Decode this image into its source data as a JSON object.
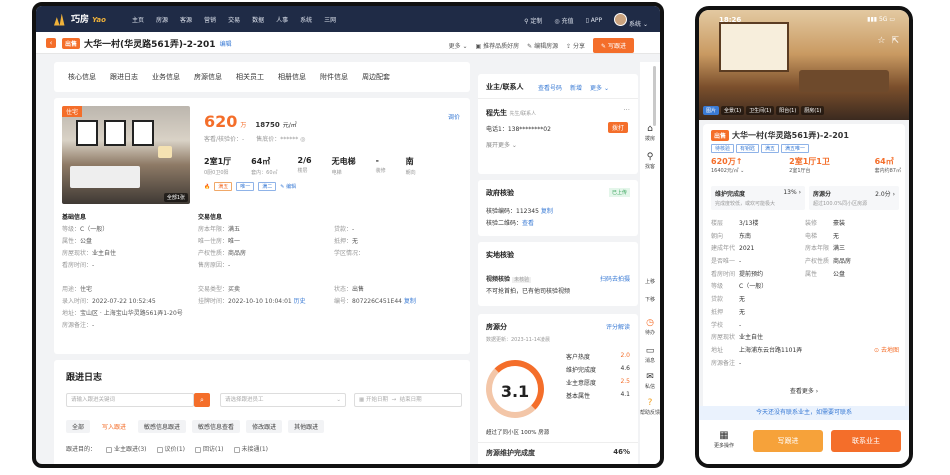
{
  "nav": {
    "logo": "巧房",
    "logo_suffix": "Yao",
    "items": [
      "主页",
      "房源",
      "客源",
      "营销",
      "交易",
      "数据",
      "人事",
      "系统",
      "三网"
    ],
    "right": [
      "定制",
      "充值",
      "APP",
      "系统"
    ]
  },
  "titlebar": {
    "tag": "出售",
    "title": "大华一村(华灵路561弄)-2-201",
    "edit": "编辑",
    "actions": [
      "更多",
      "推荐品质好房",
      "编辑房源",
      "分享"
    ],
    "follow_btn": "写跟进"
  },
  "tabs": [
    "核心信息",
    "跟进日志",
    "业务信息",
    "房源信息",
    "相关员工",
    "相册信息",
    "附件信息",
    "周边配套"
  ],
  "listing": {
    "rent_tag": "住宅",
    "all_photos": "全部1张",
    "price": "620",
    "price_unit": "万",
    "unit_price": "18750",
    "unit_price_label": "元/㎡",
    "adjust": "调价",
    "sub1": "客看/核验价：-",
    "sub2": "售底价：****** ◎",
    "stats": [
      {
        "v": "2室1厅",
        "l": "0厨0卫0阳"
      },
      {
        "v": "64㎡",
        "l": "套内：60㎡"
      },
      {
        "v": "2/6",
        "l": "楼层"
      },
      {
        "v": "无电梯",
        "l": "电梯"
      },
      {
        "v": "-",
        "l": "装修"
      },
      {
        "v": "南",
        "l": "朝向"
      }
    ],
    "chips": [
      "满五",
      "唯一",
      "满二"
    ],
    "chip_edit": "编辑"
  },
  "basic": {
    "title": "基础信息",
    "rows": [
      [
        "等级：",
        "C（一般）"
      ],
      [
        "属性：",
        "公盘"
      ],
      [
        "房屋现状：",
        "业主自住"
      ],
      [
        "看房时间：",
        "-"
      ]
    ]
  },
  "trade": {
    "title": "交易信息",
    "rows": [
      [
        "房本年限：",
        "满五"
      ],
      [
        "唯一住房：",
        "唯一"
      ],
      [
        "产权性质：",
        "商品房"
      ],
      [
        "售房原因：",
        "-"
      ]
    ]
  },
  "trade2": {
    "rows": [
      [
        "贷款：",
        "-"
      ],
      [
        "抵押：",
        "无"
      ],
      [
        "学区情况：",
        ""
      ]
    ]
  },
  "meta": {
    "rows": [
      [
        "用途：",
        "住宅",
        "交易类型：",
        "买卖",
        "状态：",
        "出售"
      ],
      [
        "录入时间：",
        "2022-07-22 10:52:45",
        "挂牌时间：",
        "2022-10-10 10:04:01",
        "编号：",
        "807226C451E44"
      ]
    ],
    "history": "历史",
    "copy": "复制",
    "address_label": "地址：",
    "address": "宝山区 · 上海宝山华灵路561弄1-20号",
    "remark_label": "房源备注：",
    "remark": "-"
  },
  "follow": {
    "title": "跟进日志",
    "placeholder1": "请输入跟进关键词",
    "placeholder2": "请选择跟进员工",
    "date_start": "开始日期",
    "date_to": "→",
    "date_end": "结束日期",
    "tabs": [
      "全部",
      "写入跟进",
      "敏感信息跟进",
      "敏感信息查看",
      "修改跟进",
      "其他跟进"
    ],
    "purpose_label": "跟进目的：",
    "purposes": [
      "业主跟进(3)",
      "议价(1)",
      "回访(1)",
      "未接通(1)"
    ]
  },
  "contact": {
    "title": "业主/联系人",
    "links": [
      "查看号码",
      "新增",
      "更多"
    ],
    "name": "程先生",
    "name_sub": "先生/联系人",
    "phone": "电话1：138********02",
    "dial": "拨打",
    "expand": "展开更多"
  },
  "verify": {
    "title": "政府核验",
    "status": "已上传",
    "code": "核验编码：112345",
    "copy": "复制",
    "qr": "核验二维码：",
    "view": "查看"
  },
  "survey": {
    "title": "实地核验",
    "label": "视频核验",
    "status": "未核验",
    "scan": "扫码去拍摄",
    "desc": "不可抢首拍，已有他司核验视频"
  },
  "score": {
    "title": "房源分",
    "link": "评分解读",
    "updated": "数据更新：2023-11-14凌晨",
    "value": "3.1",
    "compare": "超过了同小区 100% 房源",
    "items": [
      [
        "客户热度",
        "2.0"
      ],
      [
        "维护完成度",
        "4.6"
      ],
      [
        "业主意愿度",
        "2.5"
      ],
      [
        "基本属性",
        "4.1"
      ]
    ],
    "bottom": "房源维护完成度",
    "bottom_val": "46%"
  },
  "sidebar": [
    "拨房",
    "找客",
    "上移",
    "下移",
    "待办",
    "消息",
    "私信",
    "帮助反馈"
  ],
  "phone": {
    "time": "18:26",
    "signal": "5G",
    "photo_tabs": [
      "图片",
      "全景(1)",
      "卫生间(1)",
      "阳台(1)",
      "厨房(1)"
    ],
    "tag": "出售",
    "title": "大华一村(华灵路561弄)-2-201",
    "chips": [
      "待核验",
      "有钥匙",
      "满五",
      "满五唯一"
    ],
    "stats": [
      [
        "620万↑",
        "16402元/㎡ ⌄"
      ],
      [
        "2室1厅1卫",
        "2室1厅台"
      ],
      [
        "64㎡",
        "套内约87㎡"
      ]
    ],
    "maint": "维护完成度",
    "maint_val": "13% ›",
    "maint_sub": "完成度较低，或欢可能极大",
    "score": "房源分",
    "score_val": "2.0分 ›",
    "score_sub": "超过100.0%同小区房源",
    "rows": [
      [
        "楼层",
        "3/13楼",
        "装修",
        "豪装"
      ],
      [
        "朝向",
        "东南",
        "电梯",
        "无"
      ],
      [
        "建成年代",
        "2021",
        "房本年限",
        "满三"
      ],
      [
        "是否唯一",
        "-",
        "产权性质",
        "商品房"
      ],
      [
        "看房时间",
        "提前预约",
        "属性",
        "公盘"
      ],
      [
        "等级",
        "C（一般）",
        "",
        ""
      ],
      [
        "贷款",
        "无",
        "",
        ""
      ],
      [
        "抵押",
        "无",
        "",
        ""
      ],
      [
        "学校",
        "-",
        "",
        ""
      ],
      [
        "房屋现状",
        "业主自住",
        "",
        ""
      ],
      [
        "地址",
        "上海浦东云台路1101弄",
        "",
        ""
      ],
      [
        "房源备注",
        "-",
        "",
        ""
      ]
    ],
    "map": "去地图",
    "more": "查看更多 ›",
    "note": "今天还没有联系业主，如需要可联系",
    "more_ops": "更多操作",
    "write_follow": "写跟进",
    "contact_owner": "联系业主"
  }
}
